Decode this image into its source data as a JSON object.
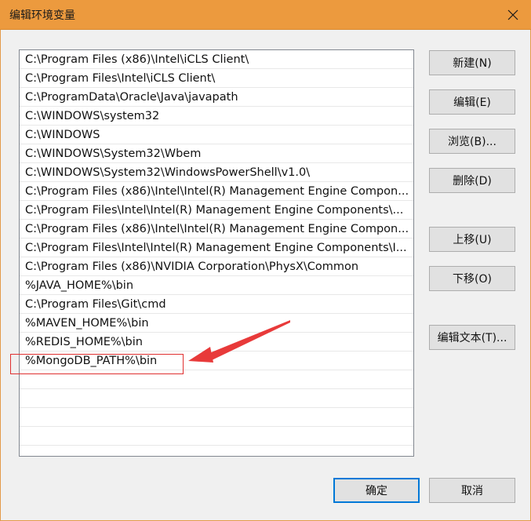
{
  "window": {
    "title": "编辑环境变量",
    "close_icon": "close-icon"
  },
  "path_list": {
    "items": [
      "C:\\Program Files (x86)\\Intel\\iCLS Client\\",
      "C:\\Program Files\\Intel\\iCLS Client\\",
      "C:\\ProgramData\\Oracle\\Java\\javapath",
      "C:\\WINDOWS\\system32",
      "C:\\WINDOWS",
      "C:\\WINDOWS\\System32\\Wbem",
      "C:\\WINDOWS\\System32\\WindowsPowerShell\\v1.0\\",
      "C:\\Program Files (x86)\\Intel\\Intel(R) Management Engine Compon...",
      "C:\\Program Files\\Intel\\Intel(R) Management Engine Components\\...",
      "C:\\Program Files (x86)\\Intel\\Intel(R) Management Engine Compon...",
      "C:\\Program Files\\Intel\\Intel(R) Management Engine Components\\I...",
      "C:\\Program Files (x86)\\NVIDIA Corporation\\PhysX\\Common",
      "%JAVA_HOME%\\bin",
      "C:\\Program Files\\Git\\cmd",
      "%MAVEN_HOME%\\bin",
      "%REDIS_HOME%\\bin",
      "%MongoDB_PATH%\\bin"
    ],
    "empty_rows": 5
  },
  "side_buttons": {
    "new": "新建(N)",
    "edit": "编辑(E)",
    "browse": "浏览(B)...",
    "delete": "删除(D)",
    "move_up": "上移(U)",
    "move_down": "下移(O)",
    "edit_text": "编辑文本(T)..."
  },
  "footer": {
    "ok": "确定",
    "cancel": "取消"
  },
  "annotation": {
    "highlight_color": "#e03030",
    "arrow_color": "#e83a3a"
  },
  "colors": {
    "titlebar": "#ec9a3e",
    "primary_border": "#0078d7"
  }
}
